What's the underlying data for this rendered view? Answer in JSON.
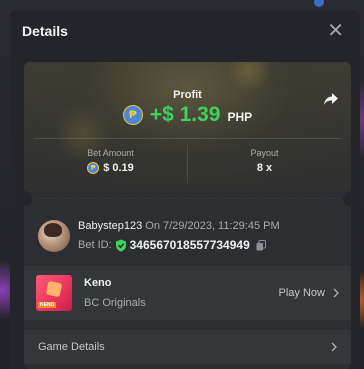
{
  "modal": {
    "title": "Details"
  },
  "profit": {
    "label": "Profit",
    "value": "+$ 1.39",
    "currency": "PHP",
    "coin_symbol": "₱"
  },
  "stats": {
    "bet_amount_label": "Bet Amount",
    "bet_amount_value": "$ 0.19",
    "payout_label": "Payout",
    "payout_value": "8 x"
  },
  "bet": {
    "username": "Babystep123",
    "timestamp": "On 7/29/2023, 11:29:45 PM",
    "bet_id_label": "Bet ID:",
    "bet_id": "346567018557734949"
  },
  "game": {
    "name": "Keno",
    "provider": "BC Originals",
    "action": "Play Now",
    "thumb_text": "KENO"
  },
  "details": {
    "label": "Game Details"
  },
  "colors": {
    "profit_green": "#3fd05d",
    "shield_green": "#3fd05d",
    "coin_blue": "#4a86d9",
    "coin_gold": "#f2c230"
  },
  "icons": {
    "close": "close-icon",
    "share": "share-icon",
    "shield": "shield-icon",
    "copy": "copy-icon",
    "chevron": "chevron-right-icon"
  }
}
